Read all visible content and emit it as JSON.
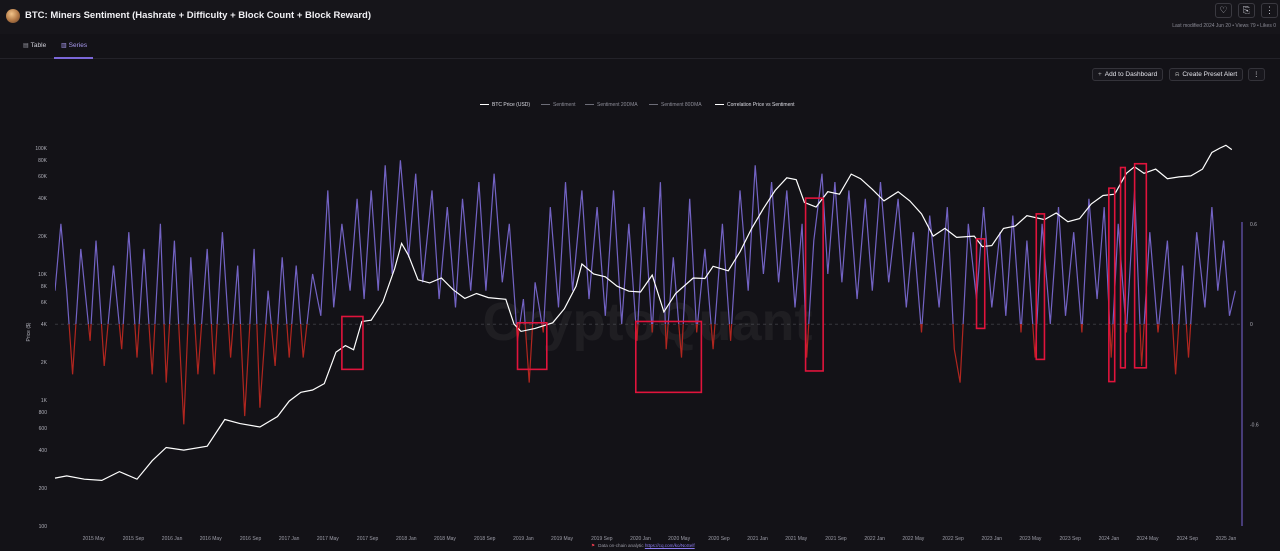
{
  "header": {
    "title": "BTC: Miners Sentiment (Hashrate + Difficulty + Block Count + Block Reward)",
    "meta": "Last modified 2024 Jun 20 • Views 79 • Likes 0",
    "favorite_icon": "heart-icon",
    "save_icon": "bookmark-icon",
    "more_icon": "more-vertical-icon"
  },
  "tabs": [
    {
      "label": "Table",
      "icon": "table-icon",
      "active": false
    },
    {
      "label": "Series",
      "icon": "chart-icon",
      "active": true
    }
  ],
  "toolbar": {
    "add_dashboard": "Add to Dashboard",
    "create_alert": "Create Preset Alert"
  },
  "footer": {
    "text": "Data on-chain analytic",
    "link": "https://cq.com/ko/NoSelf"
  },
  "watermark": "CryptoQuant",
  "colors": {
    "background": "#131217",
    "price_line": "#ffffff",
    "sentiment_positive": "#7363c4",
    "sentiment_negative": "#b1261f",
    "highlight_box": "#e0143c",
    "accent": "#7b67d9"
  },
  "chart_data": {
    "type": "line",
    "legend": [
      {
        "name": "BTC Price (USD)",
        "color": "#ffffff"
      },
      {
        "name": "Sentiment",
        "color": "#6d6d78"
      },
      {
        "name": "Sentiment 20DMA",
        "color": "#6d6d78"
      },
      {
        "name": "Sentiment 80DMA",
        "color": "#6d6d78"
      },
      {
        "name": "Correlation Price vs Sentiment",
        "color": "#ffffff"
      }
    ],
    "ylabel": "Price ($)",
    "yscale": "log",
    "ylim": [
      100,
      120000
    ],
    "y_ticks": [
      "100K",
      "80K",
      "60K",
      "40K",
      "20K",
      "10K",
      "8K",
      "6K",
      "4K",
      "2K",
      "1K",
      "800",
      "600",
      "400",
      "200",
      "100"
    ],
    "y_tick_values": [
      100000,
      80000,
      60000,
      40000,
      20000,
      10000,
      8000,
      6000,
      4000,
      2000,
      1000,
      800,
      600,
      400,
      200,
      100
    ],
    "right_ticks": [
      "0.6",
      "0",
      "-0.6"
    ],
    "right_tick_values": [
      0.6,
      0,
      -0.6
    ],
    "right_ylim": [
      -1,
      1
    ],
    "x_ticks": [
      "2015 May",
      "2015 Sep",
      "2016 Jan",
      "2016 May",
      "2016 Sep",
      "2017 Jan",
      "2017 May",
      "2017 Sep",
      "2018 Jan",
      "2018 May",
      "2018 Sep",
      "2019 Jan",
      "2019 May",
      "2019 Sep",
      "2020 Jan",
      "2020 May",
      "2020 Sep",
      "2021 Jan",
      "2021 May",
      "2021 Sep",
      "2022 Jan",
      "2022 May",
      "2022 Sep",
      "2023 Jan",
      "2023 May",
      "2023 Sep",
      "2024 Jan",
      "2024 May",
      "2024 Sep",
      "2025 Jan"
    ],
    "x_tick_values": [
      2015.33,
      2015.67,
      2016.0,
      2016.33,
      2016.67,
      2017.0,
      2017.33,
      2017.67,
      2018.0,
      2018.33,
      2018.67,
      2019.0,
      2019.33,
      2019.67,
      2020.0,
      2020.33,
      2020.67,
      2021.0,
      2021.33,
      2021.67,
      2022.0,
      2022.33,
      2022.67,
      2023.0,
      2023.33,
      2023.67,
      2024.0,
      2024.33,
      2024.67,
      2025.0
    ],
    "xlim": [
      2015.0,
      2025.12
    ],
    "price_series": [
      [
        2015.0,
        240
      ],
      [
        2015.1,
        250
      ],
      [
        2015.25,
        235
      ],
      [
        2015.4,
        230
      ],
      [
        2015.55,
        270
      ],
      [
        2015.7,
        235
      ],
      [
        2015.83,
        330
      ],
      [
        2015.95,
        420
      ],
      [
        2016.1,
        400
      ],
      [
        2016.3,
        430
      ],
      [
        2016.45,
        700
      ],
      [
        2016.58,
        650
      ],
      [
        2016.75,
        610
      ],
      [
        2016.9,
        740
      ],
      [
        2017.0,
        980
      ],
      [
        2017.1,
        1150
      ],
      [
        2017.2,
        1200
      ],
      [
        2017.3,
        1350
      ],
      [
        2017.4,
        2400
      ],
      [
        2017.48,
        2700
      ],
      [
        2017.55,
        2500
      ],
      [
        2017.62,
        4200
      ],
      [
        2017.7,
        4300
      ],
      [
        2017.8,
        6000
      ],
      [
        2017.9,
        11000
      ],
      [
        2017.96,
        17500
      ],
      [
        2018.02,
        14000
      ],
      [
        2018.1,
        9000
      ],
      [
        2018.2,
        8500
      ],
      [
        2018.3,
        9300
      ],
      [
        2018.4,
        7500
      ],
      [
        2018.5,
        6400
      ],
      [
        2018.6,
        7000
      ],
      [
        2018.7,
        6500
      ],
      [
        2018.85,
        6300
      ],
      [
        2018.92,
        4000
      ],
      [
        2018.98,
        3500
      ],
      [
        2019.1,
        3700
      ],
      [
        2019.25,
        4100
      ],
      [
        2019.35,
        5300
      ],
      [
        2019.45,
        8000
      ],
      [
        2019.5,
        12000
      ],
      [
        2019.6,
        10000
      ],
      [
        2019.7,
        9500
      ],
      [
        2019.8,
        8000
      ],
      [
        2019.9,
        7300
      ],
      [
        2020.0,
        7200
      ],
      [
        2020.1,
        9800
      ],
      [
        2020.2,
        5000
      ],
      [
        2020.3,
        7000
      ],
      [
        2020.45,
        9300
      ],
      [
        2020.55,
        9200
      ],
      [
        2020.62,
        11500
      ],
      [
        2020.75,
        10600
      ],
      [
        2020.85,
        15000
      ],
      [
        2020.95,
        23000
      ],
      [
        2021.05,
        33000
      ],
      [
        2021.15,
        46000
      ],
      [
        2021.25,
        58000
      ],
      [
        2021.33,
        56000
      ],
      [
        2021.4,
        37000
      ],
      [
        2021.5,
        34000
      ],
      [
        2021.6,
        45000
      ],
      [
        2021.7,
        43000
      ],
      [
        2021.8,
        62000
      ],
      [
        2021.88,
        57000
      ],
      [
        2021.98,
        47000
      ],
      [
        2022.08,
        38000
      ],
      [
        2022.2,
        45000
      ],
      [
        2022.3,
        38000
      ],
      [
        2022.4,
        30000
      ],
      [
        2022.5,
        20000
      ],
      [
        2022.6,
        23000
      ],
      [
        2022.7,
        19500
      ],
      [
        2022.85,
        20000
      ],
      [
        2022.92,
        16500
      ],
      [
        2023.0,
        16800
      ],
      [
        2023.1,
        23000
      ],
      [
        2023.2,
        24000
      ],
      [
        2023.3,
        29000
      ],
      [
        2023.45,
        27000
      ],
      [
        2023.55,
        30500
      ],
      [
        2023.65,
        26000
      ],
      [
        2023.75,
        27500
      ],
      [
        2023.85,
        36000
      ],
      [
        2023.95,
        42000
      ],
      [
        2024.05,
        43000
      ],
      [
        2024.15,
        63000
      ],
      [
        2024.22,
        71000
      ],
      [
        2024.3,
        63000
      ],
      [
        2024.4,
        68000
      ],
      [
        2024.5,
        57000
      ],
      [
        2024.6,
        59000
      ],
      [
        2024.7,
        60000
      ],
      [
        2024.8,
        68000
      ],
      [
        2024.88,
        92000
      ],
      [
        2024.95,
        100000
      ],
      [
        2025.0,
        105000
      ],
      [
        2025.05,
        97000
      ]
    ],
    "sentiment_series": [
      [
        2015.0,
        0.2
      ],
      [
        2015.05,
        0.6
      ],
      [
        2015.1,
        0.2
      ],
      [
        2015.15,
        -0.3
      ],
      [
        2015.22,
        0.45
      ],
      [
        2015.3,
        -0.1
      ],
      [
        2015.35,
        0.5
      ],
      [
        2015.42,
        -0.25
      ],
      [
        2015.5,
        0.35
      ],
      [
        2015.57,
        -0.15
      ],
      [
        2015.63,
        0.55
      ],
      [
        2015.7,
        -0.2
      ],
      [
        2015.76,
        0.45
      ],
      [
        2015.83,
        -0.3
      ],
      [
        2015.9,
        0.6
      ],
      [
        2015.95,
        -0.35
      ],
      [
        2016.02,
        0.5
      ],
      [
        2016.1,
        -0.6
      ],
      [
        2016.16,
        0.4
      ],
      [
        2016.22,
        -0.3
      ],
      [
        2016.3,
        0.45
      ],
      [
        2016.36,
        -0.3
      ],
      [
        2016.43,
        0.55
      ],
      [
        2016.5,
        -0.2
      ],
      [
        2016.56,
        0.35
      ],
      [
        2016.62,
        -0.55
      ],
      [
        2016.7,
        0.45
      ],
      [
        2016.75,
        -0.5
      ],
      [
        2016.82,
        0.2
      ],
      [
        2016.88,
        -0.25
      ],
      [
        2016.94,
        0.4
      ],
      [
        2017.0,
        -0.2
      ],
      [
        2017.06,
        0.35
      ],
      [
        2017.12,
        -0.2
      ],
      [
        2017.2,
        0.3
      ],
      [
        2017.27,
        0.05
      ],
      [
        2017.33,
        0.8
      ],
      [
        2017.38,
        0.1
      ],
      [
        2017.45,
        0.6
      ],
      [
        2017.52,
        0.2
      ],
      [
        2017.58,
        0.75
      ],
      [
        2017.64,
        0.15
      ],
      [
        2017.7,
        0.8
      ],
      [
        2017.76,
        0.2
      ],
      [
        2017.82,
        0.95
      ],
      [
        2017.88,
        0.3
      ],
      [
        2017.95,
        0.98
      ],
      [
        2018.02,
        0.4
      ],
      [
        2018.08,
        0.9
      ],
      [
        2018.14,
        0.25
      ],
      [
        2018.22,
        0.8
      ],
      [
        2018.28,
        0.15
      ],
      [
        2018.35,
        0.7
      ],
      [
        2018.42,
        0.1
      ],
      [
        2018.48,
        0.75
      ],
      [
        2018.55,
        0.2
      ],
      [
        2018.62,
        0.85
      ],
      [
        2018.68,
        0.2
      ],
      [
        2018.75,
        0.9
      ],
      [
        2018.82,
        0.25
      ],
      [
        2018.88,
        0.6
      ],
      [
        2018.95,
        -0.1
      ],
      [
        2019.0,
        0.15
      ],
      [
        2019.05,
        -0.35
      ],
      [
        2019.1,
        0.25
      ],
      [
        2019.17,
        -0.05
      ],
      [
        2019.23,
        0.7
      ],
      [
        2019.3,
        0.1
      ],
      [
        2019.36,
        0.85
      ],
      [
        2019.42,
        0.2
      ],
      [
        2019.5,
        0.8
      ],
      [
        2019.56,
        0.15
      ],
      [
        2019.63,
        0.7
      ],
      [
        2019.7,
        0.05
      ],
      [
        2019.77,
        0.8
      ],
      [
        2019.84,
        0.0
      ],
      [
        2019.9,
        0.6
      ],
      [
        2019.97,
        -0.1
      ],
      [
        2020.03,
        0.7
      ],
      [
        2020.1,
        -0.05
      ],
      [
        2020.17,
        0.85
      ],
      [
        2020.22,
        -0.15
      ],
      [
        2020.28,
        0.4
      ],
      [
        2020.35,
        -0.2
      ],
      [
        2020.42,
        0.75
      ],
      [
        2020.48,
        -0.05
      ],
      [
        2020.55,
        0.45
      ],
      [
        2020.62,
        -0.15
      ],
      [
        2020.7,
        0.6
      ],
      [
        2020.77,
        -0.1
      ],
      [
        2020.85,
        0.8
      ],
      [
        2020.92,
        0.2
      ],
      [
        2020.98,
        0.95
      ],
      [
        2021.05,
        0.3
      ],
      [
        2021.12,
        0.85
      ],
      [
        2021.18,
        0.25
      ],
      [
        2021.25,
        0.8
      ],
      [
        2021.32,
        0.1
      ],
      [
        2021.38,
        0.6
      ],
      [
        2021.42,
        -0.2
      ],
      [
        2021.48,
        0.5
      ],
      [
        2021.55,
        0.9
      ],
      [
        2021.6,
        0.3
      ],
      [
        2021.66,
        0.85
      ],
      [
        2021.72,
        0.25
      ],
      [
        2021.78,
        0.8
      ],
      [
        2021.85,
        0.15
      ],
      [
        2021.92,
        0.75
      ],
      [
        2021.98,
        0.2
      ],
      [
        2022.05,
        0.85
      ],
      [
        2022.12,
        0.25
      ],
      [
        2022.2,
        0.75
      ],
      [
        2022.27,
        0.1
      ],
      [
        2022.33,
        0.55
      ],
      [
        2022.4,
        -0.05
      ],
      [
        2022.47,
        0.65
      ],
      [
        2022.55,
        0.1
      ],
      [
        2022.62,
        0.7
      ],
      [
        2022.68,
        -0.15
      ],
      [
        2022.73,
        -0.35
      ],
      [
        2022.8,
        0.6
      ],
      [
        2022.87,
        0.15
      ],
      [
        2022.93,
        0.7
      ],
      [
        2023.0,
        0.1
      ],
      [
        2023.07,
        0.55
      ],
      [
        2023.12,
        0.05
      ],
      [
        2023.18,
        0.65
      ],
      [
        2023.25,
        -0.05
      ],
      [
        2023.3,
        0.5
      ],
      [
        2023.37,
        -0.2
      ],
      [
        2023.43,
        0.6
      ],
      [
        2023.5,
        0.0
      ],
      [
        2023.57,
        0.7
      ],
      [
        2023.63,
        0.05
      ],
      [
        2023.7,
        0.55
      ],
      [
        2023.77,
        -0.05
      ],
      [
        2023.83,
        0.75
      ],
      [
        2023.9,
        0.15
      ],
      [
        2023.96,
        0.7
      ],
      [
        2024.02,
        -0.2
      ],
      [
        2024.08,
        0.6
      ],
      [
        2024.15,
        -0.05
      ],
      [
        2024.22,
        0.8
      ],
      [
        2024.28,
        -0.25
      ],
      [
        2024.35,
        0.55
      ],
      [
        2024.42,
        -0.05
      ],
      [
        2024.5,
        0.5
      ],
      [
        2024.57,
        -0.3
      ],
      [
        2024.63,
        0.35
      ],
      [
        2024.68,
        -0.2
      ],
      [
        2024.75,
        0.55
      ],
      [
        2024.82,
        0.1
      ],
      [
        2024.88,
        0.7
      ],
      [
        2024.93,
        0.2
      ],
      [
        2024.98,
        0.5
      ],
      [
        2025.03,
        0.05
      ],
      [
        2025.08,
        0.2
      ]
    ],
    "highlight_boxes": [
      {
        "x": [
          2017.45,
          2017.63
        ],
        "price": [
          1750,
          4600
        ]
      },
      {
        "x": [
          2018.95,
          2019.2
        ],
        "price": [
          1750,
          4100
        ]
      },
      {
        "x": [
          2019.96,
          2020.52
        ],
        "price": [
          1150,
          4200
        ]
      },
      {
        "x": [
          2021.41,
          2021.56
        ],
        "price": [
          1700,
          40000
        ]
      },
      {
        "x": [
          2022.87,
          2022.94
        ],
        "price": [
          3700,
          19000
        ]
      },
      {
        "x": [
          2023.38,
          2023.45
        ],
        "price": [
          2100,
          30000
        ]
      },
      {
        "x": [
          2024.0,
          2024.05
        ],
        "price": [
          1400,
          48000
        ]
      },
      {
        "x": [
          2024.1,
          2024.14
        ],
        "price": [
          1800,
          70000
        ]
      },
      {
        "x": [
          2024.22,
          2024.32
        ],
        "price": [
          1800,
          75000
        ]
      }
    ]
  }
}
